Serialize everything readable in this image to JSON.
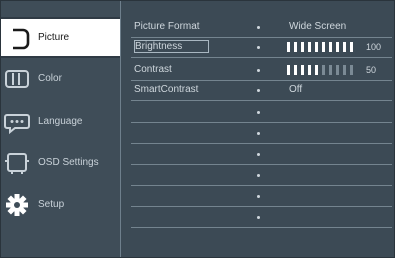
{
  "sidebar": {
    "items": [
      {
        "label": "Picture",
        "icon": "monitor-icon",
        "active": true
      },
      {
        "label": "Color",
        "icon": "color-icon",
        "active": false
      },
      {
        "label": "Language",
        "icon": "language-icon",
        "active": false
      },
      {
        "label": "OSD Settings",
        "icon": "osd-settings-icon",
        "active": false
      },
      {
        "label": "Setup",
        "icon": "gear-icon",
        "active": false
      }
    ]
  },
  "settings": {
    "rows": [
      {
        "name": "Picture  Format",
        "value": "Wide Screen"
      },
      {
        "name": "Brightness",
        "value": "100",
        "level": 1.0
      },
      {
        "name": "Contrast",
        "value": "50",
        "level": 0.5
      },
      {
        "name": "SmartContrast",
        "value": "Off"
      }
    ]
  },
  "colors": {
    "panel": "#3c4a55",
    "active_tab": "#ffffff",
    "text": "#cfd7dd"
  }
}
